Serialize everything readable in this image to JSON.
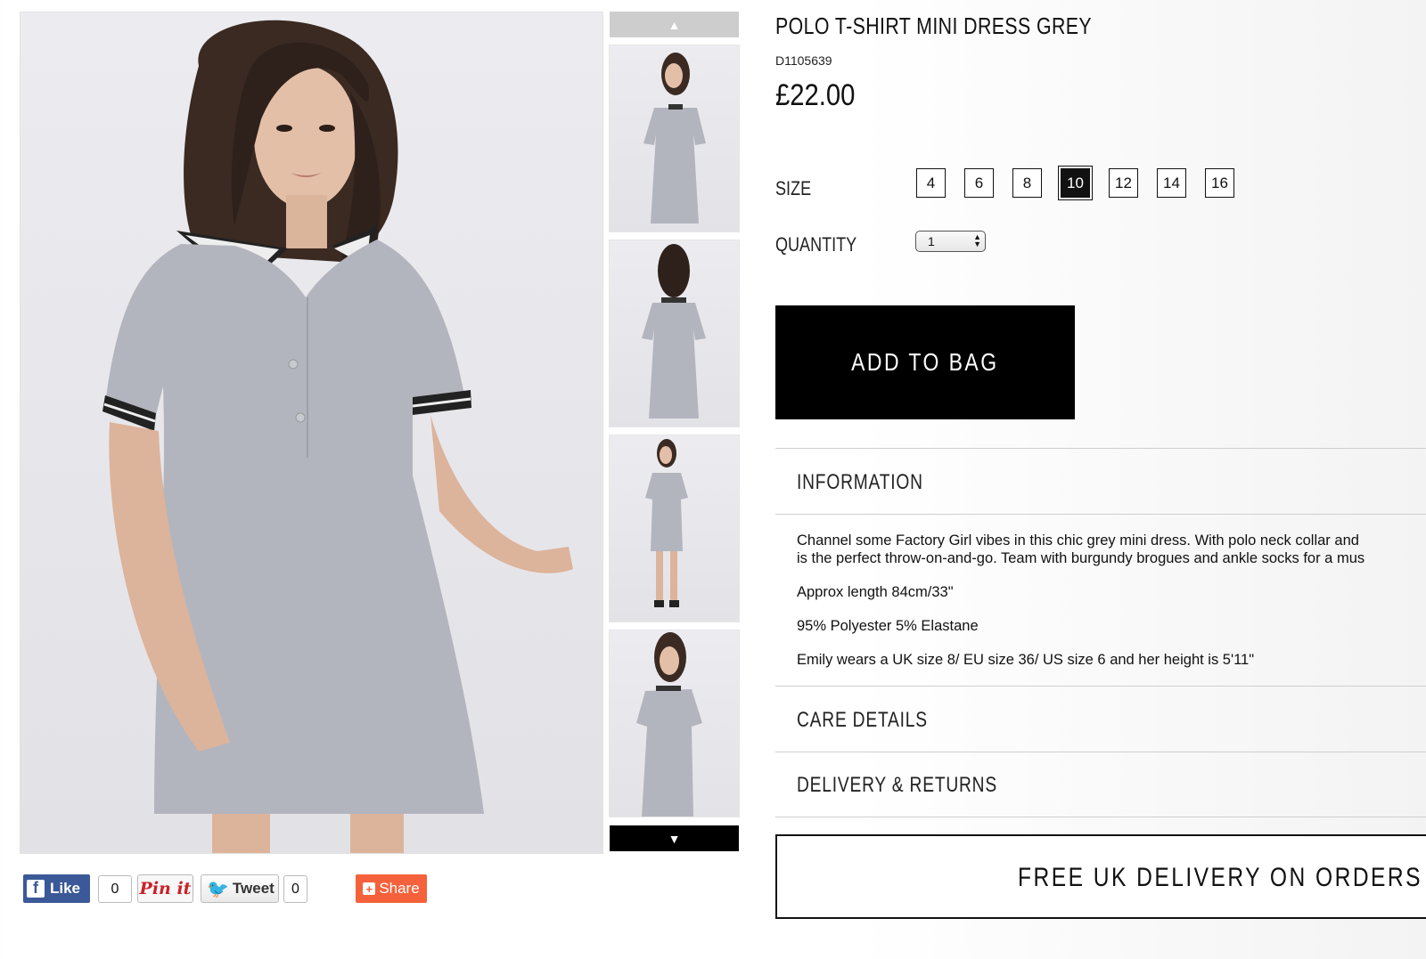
{
  "product": {
    "title": "POLO T-SHIRT MINI DRESS GREY",
    "sku": "D1105639",
    "price": "£22.00"
  },
  "gallery": {
    "up_arrow": "▲",
    "down_arrow": "▼",
    "thumbnail_count": 4
  },
  "size": {
    "label": "SIZE",
    "options": [
      "4",
      "6",
      "8",
      "10",
      "12",
      "14",
      "16"
    ],
    "selected": "10"
  },
  "quantity": {
    "label": "QUANTITY",
    "value": "1"
  },
  "add_to_bag_label": "ADD TO BAG",
  "information": {
    "heading": "INFORMATION",
    "description_line1": "Channel some Factory Girl vibes in this chic grey mini dress. With polo neck collar and",
    "description_line2": "is the perfect throw-on-and-go. Team with burgundy brogues and ankle socks for a mus",
    "length": "Approx length 84cm/33\"",
    "composition": "95% Polyester 5% Elastane",
    "model_info": "Emily wears a UK size 8/ EU size 36/ US size 6 and her height is 5'11\""
  },
  "care_details_heading": "CARE DETAILS",
  "delivery_returns_heading": "DELIVERY & RETURNS",
  "delivery_banner": "FREE UK DELIVERY ON ORDERS OVER",
  "social": {
    "like_label": "Like",
    "like_count": "0",
    "pin_label": "Pin it",
    "tweet_label": "Tweet",
    "tweet_count": "0",
    "share_label": "Share"
  },
  "colors": {
    "button_black": "#000000",
    "facebook_blue": "#3b5998",
    "share_orange": "#f5613b",
    "pinterest_red": "#cb2027",
    "dress_grey": "#b2b4bd"
  }
}
